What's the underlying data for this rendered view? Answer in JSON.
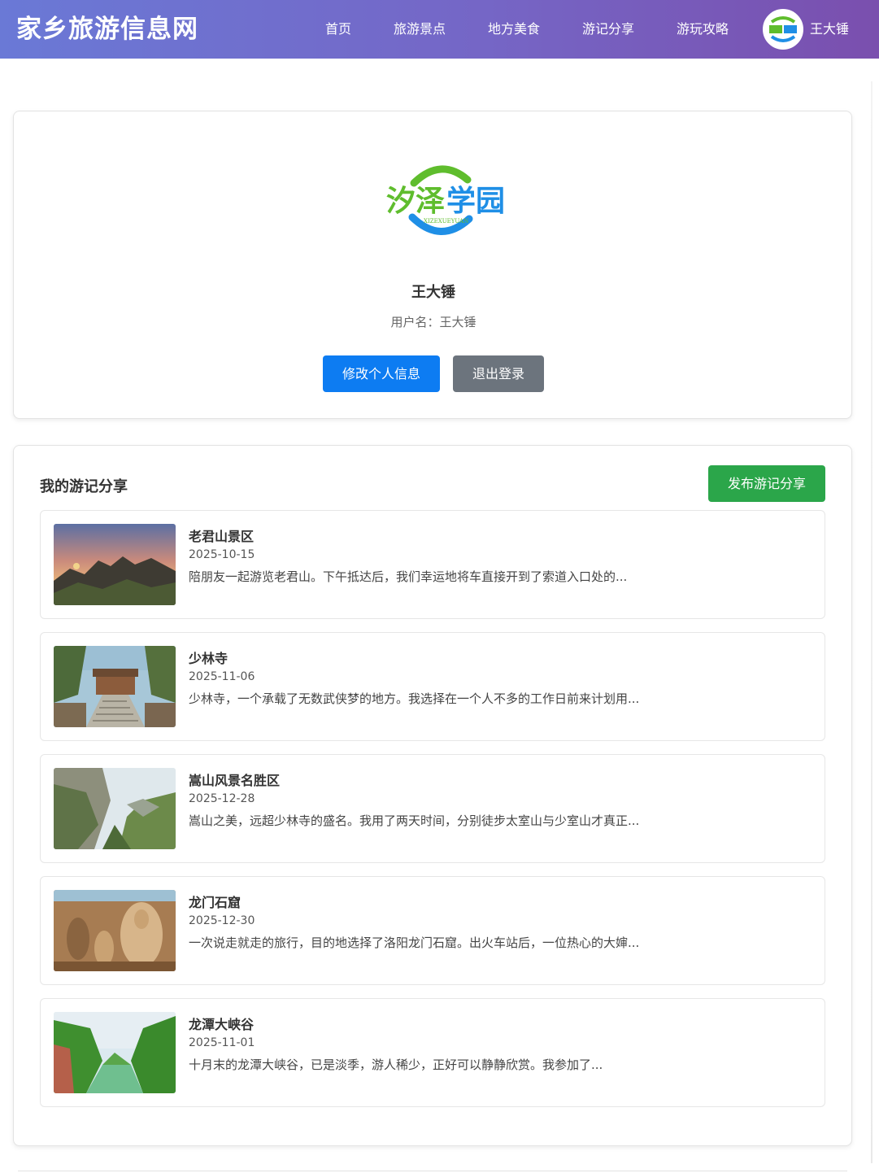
{
  "header": {
    "site_title": "家乡旅游信息网",
    "nav": [
      {
        "label": "首页"
      },
      {
        "label": "旅游景点"
      },
      {
        "label": "地方美食"
      },
      {
        "label": "游记分享"
      },
      {
        "label": "游玩攻略"
      }
    ],
    "user_name": "王大锤",
    "avatar_icon": "xize-xueyuan-logo-icon",
    "gradient_colors": [
      "#6a79d6",
      "#7a4fae"
    ]
  },
  "profile": {
    "logo_text": "汐泽学园",
    "logo_subtext": "XIZEXUEYUAN",
    "display_name": "王大锤",
    "username_label": "用户名：王大锤",
    "edit_button": "修改个人信息",
    "logout_button": "退出登录",
    "colors": {
      "edit": "#0d7cf2",
      "logout": "#6c747d"
    }
  },
  "travel_notes": {
    "section_title": "我的游记分享",
    "publish_button": "发布游记分享",
    "publish_color": "#2ba64a",
    "items": [
      {
        "title": "老君山景区",
        "date": "2025-10-15",
        "excerpt": "陪朋友一起游览老君山。下午抵达后，我们幸运地将车直接开到了索道入口处的..."
      },
      {
        "title": "少林寺",
        "date": "2025-11-06",
        "excerpt": "少林寺，一个承载了无数武侠梦的地方。我选择在一个人不多的工作日前来计划用..."
      },
      {
        "title": "嵩山风景名胜区",
        "date": "2025-12-28",
        "excerpt": "嵩山之美，远超少林寺的盛名。我用了两天时间，分别徒步太室山与少室山才真正..."
      },
      {
        "title": "龙门石窟",
        "date": "2025-12-30",
        "excerpt": "一次说走就走的旅行，目的地选择了洛阳龙门石窟。出火车站后，一位热心的大婶..."
      },
      {
        "title": "龙潭大峡谷",
        "date": "2025-11-01",
        "excerpt": "十月末的龙潭大峡谷，已是淡季，游人稀少，正好可以静静欣赏。我参加了..."
      }
    ]
  }
}
